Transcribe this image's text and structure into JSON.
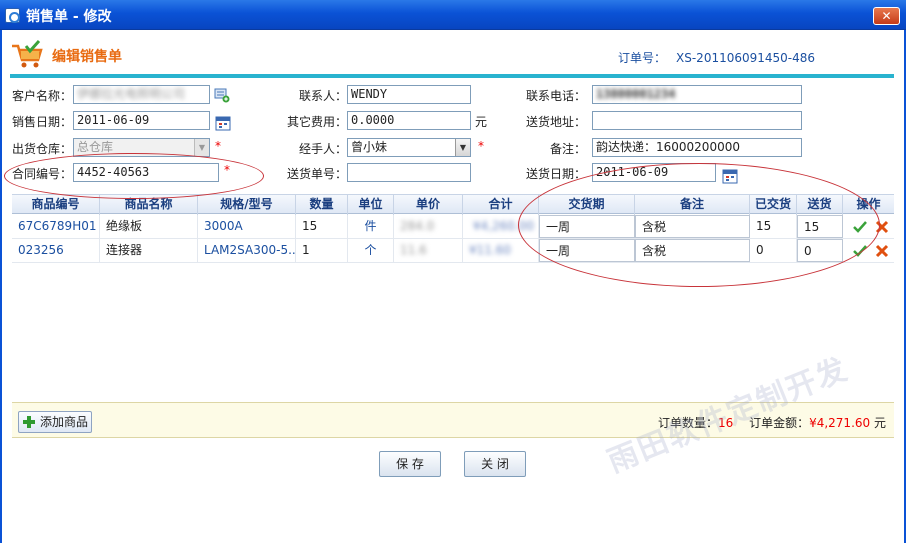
{
  "window": {
    "title": "销售单 - 修改",
    "close_glyph": "✕"
  },
  "header": {
    "title": "编辑销售单",
    "order_label": "订单号：",
    "order_no": "XS-201106091450-486",
    "icon": "cart-check-icon"
  },
  "form": {
    "customer_label": "客户名称：",
    "customer_value": "伊娜拉光电照明公司",
    "contact_label": "联系人：",
    "contact_value": "WENDY",
    "phone_label": "联系电话：",
    "phone_value": "13800001234",
    "sale_date_label": "销售日期：",
    "sale_date_value": "2011-06-09",
    "other_fee_label": "其它费用：",
    "other_fee_value": "0.0000",
    "other_fee_unit": "元",
    "ship_addr_label": "送货地址：",
    "ship_addr_value": "",
    "warehouse_label": "出货仓库：",
    "warehouse_value": "总仓库",
    "handler_label": "经手人：",
    "handler_value": "曾小妹",
    "remark_label": "备注：",
    "remark_value": "韵达快递：16000200000",
    "contract_label": "合同编号：",
    "contract_value": "4452-40563",
    "delivery_no_label": "送货单号：",
    "delivery_no_value": "",
    "delivery_date_label": "送货日期：",
    "delivery_date_value": "2011-06-09",
    "required_mark": "*"
  },
  "grid": {
    "headers": [
      "商品编号",
      "商品名称",
      "规格/型号",
      "数量",
      "单位",
      "单价",
      "合计",
      "交货期",
      "备注",
      "已交货",
      "送货",
      "操作"
    ],
    "rows": [
      {
        "code": "67C6789H01",
        "name": "绝缘板",
        "spec": "3000A",
        "qty": "15",
        "unit": "件",
        "price": "284.0",
        "total": "¥4,260.00",
        "due": "一周",
        "remark": "含税",
        "delivered": "15",
        "ship": "15"
      },
      {
        "code": "023256",
        "name": "连接器",
        "spec": "LAM2SA300-5...",
        "qty": "1",
        "unit": "个",
        "price": "11.6",
        "total": "¥11.60",
        "due": "一周",
        "remark": "含税",
        "delivered": "0",
        "ship": "0"
      }
    ]
  },
  "footer": {
    "add_label": "添加商品",
    "count_label": "订单数量：",
    "count_value": "16",
    "amount_label": "订单金额：",
    "amount_value": "¥4,271.60",
    "amount_unit": "元"
  },
  "buttons": {
    "save": "保 存",
    "close": "关 闭"
  },
  "watermark": "雨田软件定制开发",
  "colors": {
    "title_bar": "#0a52d6",
    "accent_orange": "#e86a10",
    "link_blue": "#1b4fa0",
    "rule_cyan": "#29b3cf",
    "annotation_red": "#c8343a"
  }
}
